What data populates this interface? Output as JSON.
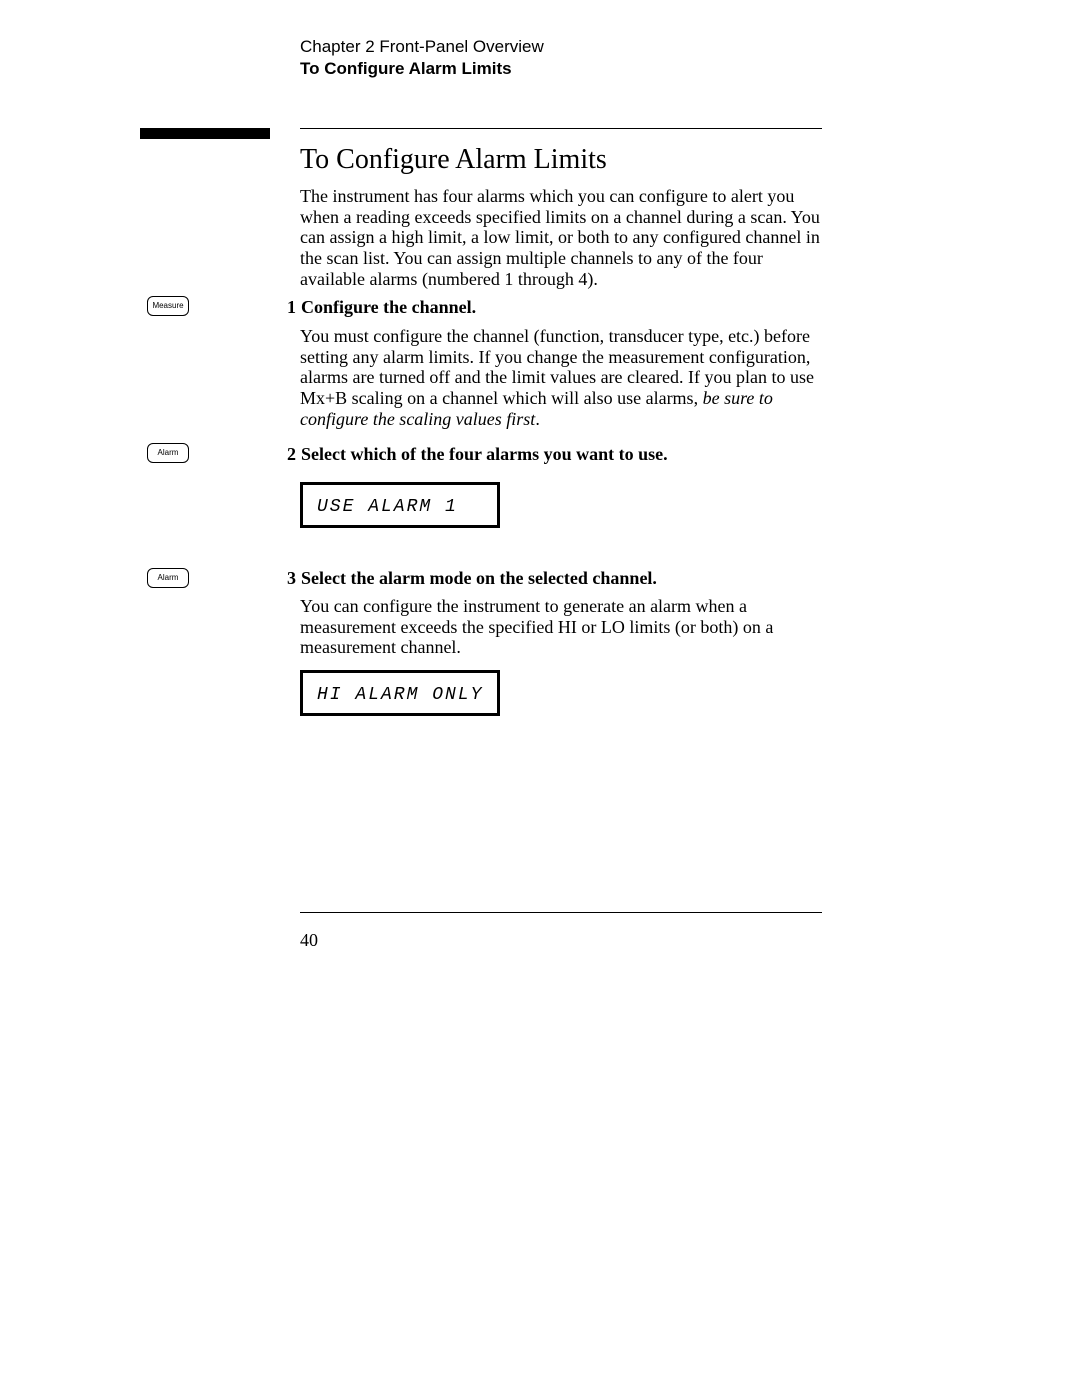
{
  "header": {
    "chapter": "Chapter 2  Front-Panel Overview",
    "section": "To Configure Alarm Limits"
  },
  "title": "To Configure Alarm Limits",
  "intro": "The instrument has four alarms which you can configure to alert you when a reading exceeds specified limits on a channel during a scan. You can assign a high limit, a low limit, or both to any configured channel in the scan list. You can assign multiple channels to any of the four available alarms (numbered 1 through 4).",
  "keys": {
    "measure": "Measure",
    "alarm": "Alarm"
  },
  "steps": {
    "s1": {
      "num": "1",
      "title": "Configure the channel.",
      "body_pre": "You must configure the channel (function, transducer type, etc.) before setting any alarm limits. If you change the measurement configuration, alarms are turned off and the limit values are cleared. If you plan to use Mx+B scaling on a channel which will also use alarms, ",
      "body_ital": "be sure to configure the scaling values first",
      "body_post": "."
    },
    "s2": {
      "num": "2",
      "title": "Select which of the four alarms you want to use.",
      "lcd": "USE ALARM 1"
    },
    "s3": {
      "num": "3",
      "title": "Select the alarm mode on the selected channel.",
      "body": "You can configure the instrument to generate an alarm when a measurement exceeds the specified HI or LO limits (or both) on a measurement channel.",
      "lcd": "HI ALARM ONLY"
    }
  },
  "page_number": "40"
}
